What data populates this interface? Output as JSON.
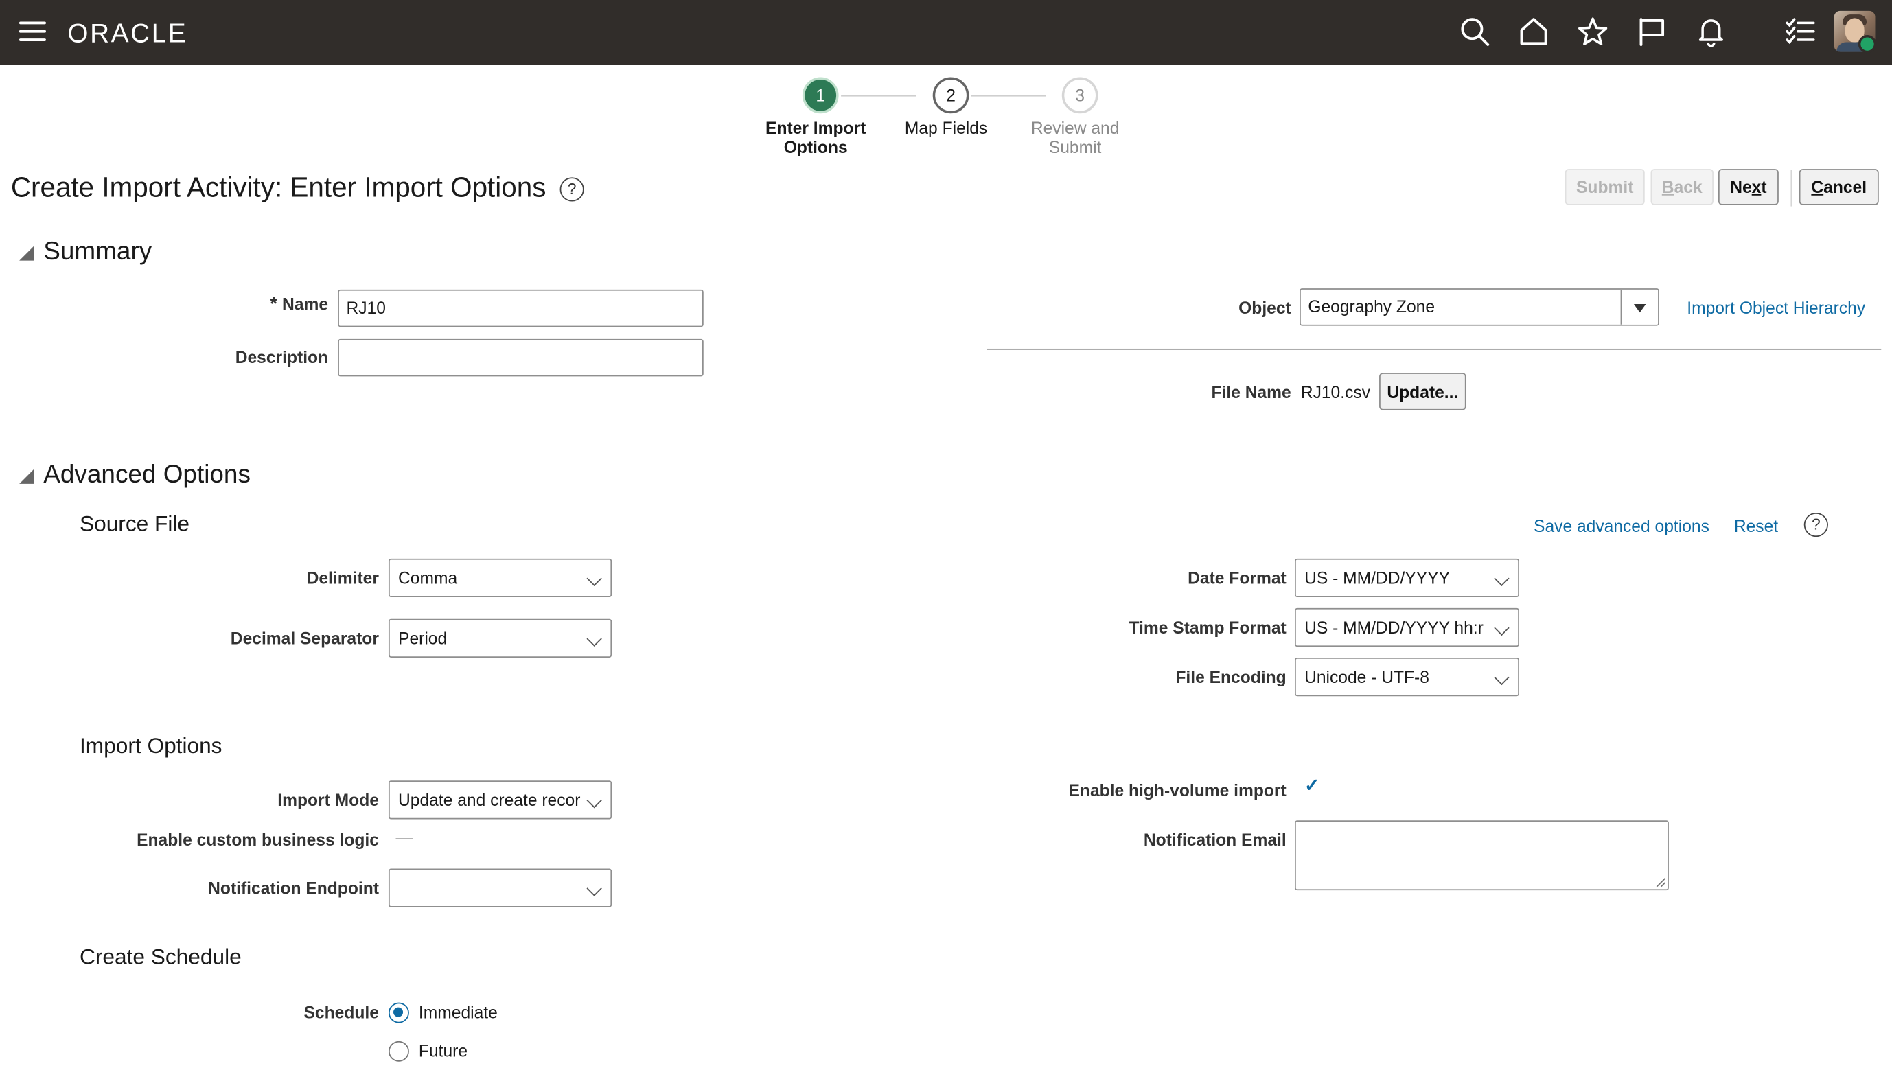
{
  "header": {
    "logo": "ORACLE",
    "icons": [
      "menu-icon",
      "search-icon",
      "home-icon",
      "star-icon",
      "flag-icon",
      "bell-icon",
      "checklist-icon"
    ]
  },
  "train": {
    "stops": [
      {
        "number": "1",
        "label": "Enter Import Options"
      },
      {
        "number": "2",
        "label": "Map Fields"
      },
      {
        "number": "3",
        "label": "Review and Submit"
      }
    ]
  },
  "page": {
    "title": "Create Import Activity: Enter Import Options",
    "help": "?"
  },
  "toolbar": {
    "submit": "Submit",
    "back": "Back",
    "next": "Next",
    "cancel": "Cancel"
  },
  "summary": {
    "heading": "Summary",
    "required_mark": "*",
    "name_label": "Name",
    "name_value": "RJ10",
    "description_label": "Description",
    "description_value": "",
    "object_label": "Object",
    "object_value": "Geography Zone",
    "hierarchy_link": "Import Object Hierarchy",
    "file_name_label": "File Name",
    "file_name_value": "RJ10.csv",
    "update_button": "Update..."
  },
  "advanced": {
    "heading": "Advanced Options",
    "source_file": {
      "heading": "Source File",
      "save_link": "Save advanced options",
      "reset_link": "Reset",
      "delimiter_label": "Delimiter",
      "delimiter_value": "Comma",
      "decimal_label": "Decimal Separator",
      "decimal_value": "Period",
      "date_format_label": "Date Format",
      "date_format_value": "US - MM/DD/YYYY",
      "timestamp_label": "Time Stamp Format",
      "timestamp_value": "US - MM/DD/YYYY hh:r",
      "encoding_label": "File Encoding",
      "encoding_value": "Unicode - UTF-8"
    },
    "import_options": {
      "heading": "Import Options",
      "import_mode_label": "Import Mode",
      "import_mode_value": "Update and create recor",
      "custom_logic_label": "Enable custom business logic",
      "custom_logic_value": "—",
      "endpoint_label": "Notification Endpoint",
      "endpoint_value": "",
      "high_volume_label": "Enable high-volume import",
      "high_volume_value": "✓",
      "email_label": "Notification Email",
      "email_value": ""
    },
    "schedule": {
      "heading": "Create Schedule",
      "schedule_label": "Schedule",
      "options": [
        {
          "label": "Immediate",
          "selected": true
        },
        {
          "label": "Future",
          "selected": false
        }
      ]
    }
  },
  "colors": {
    "header_bg": "#312d2a",
    "accent_green": "#2d7a55",
    "link_blue": "#0e6aa3"
  }
}
